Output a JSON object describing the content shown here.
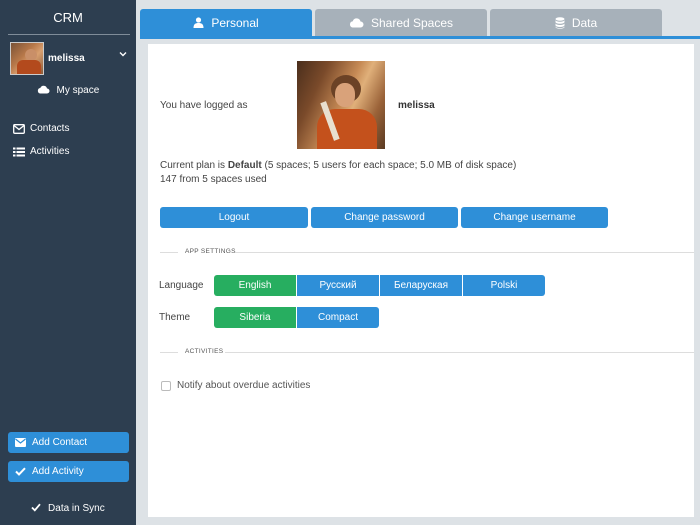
{
  "app": {
    "title": "CRM"
  },
  "user": {
    "name": "melissa"
  },
  "sidebar": {
    "my_space": "My space",
    "items": [
      {
        "label": "Contacts",
        "icon": "envelope-icon"
      },
      {
        "label": "Activities",
        "icon": "list-icon"
      }
    ],
    "add_contact": "Add Contact",
    "add_activity": "Add Activity",
    "sync_status": "Data in Sync"
  },
  "tabs": [
    {
      "label": "Personal",
      "icon": "user-icon",
      "active": true
    },
    {
      "label": "Shared Spaces",
      "icon": "cloud-icon",
      "active": false
    },
    {
      "label": "Data",
      "icon": "database-icon",
      "active": false
    }
  ],
  "personal": {
    "logged_as_label": "You have logged as",
    "username": "melissa",
    "plan_prefix": "Current plan is ",
    "plan_name": "Default",
    "plan_details": " (5 spaces; 5 users for each space; 5.0 MB of disk space)",
    "usage": "147 from 5 spaces used",
    "buttons": {
      "logout": "Logout",
      "change_password": "Change password",
      "change_username": "Change username"
    }
  },
  "app_settings": {
    "section_title": "APP SETTINGS",
    "language_label": "Language",
    "languages": [
      "English",
      "Русский",
      "Беларуская",
      "Polski"
    ],
    "selected_language": "English",
    "theme_label": "Theme",
    "themes": [
      "Siberia",
      "Compact"
    ],
    "selected_theme": "Siberia"
  },
  "activities": {
    "section_title": "ACTIVITIES",
    "notify_label": "Notify about overdue activities",
    "notify_checked": false
  },
  "colors": {
    "sidebar_bg": "#2d3e50",
    "accent": "#2e8fd8",
    "selected": "#27ae60",
    "inactive_tab": "#a7b1ba"
  }
}
